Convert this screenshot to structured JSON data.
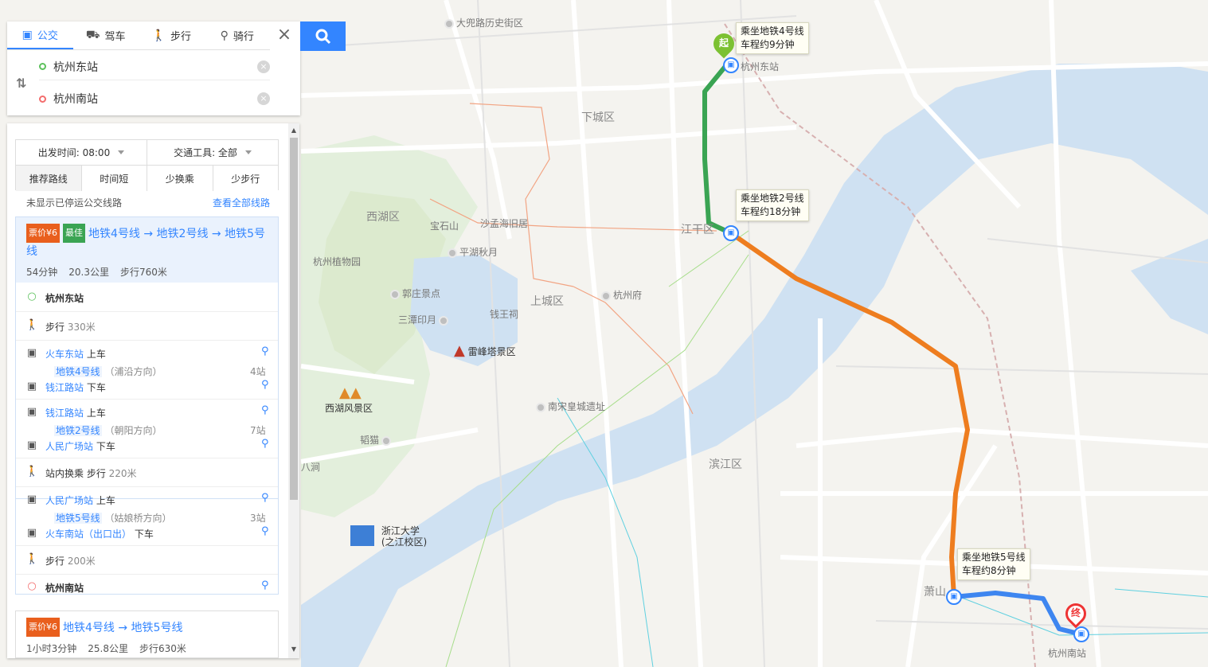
{
  "search": {
    "modes": [
      {
        "label": "公交",
        "icon": "bus-icon",
        "active": true
      },
      {
        "label": "驾车",
        "icon": "car-icon",
        "active": false
      },
      {
        "label": "步行",
        "icon": "walk-icon",
        "active": false
      },
      {
        "label": "骑行",
        "icon": "bike-icon",
        "active": false
      }
    ],
    "origin": "杭州东站",
    "destination": "杭州南站"
  },
  "filters": {
    "depart_time": "出发时间: 08:00",
    "transport": "交通工具: 全部",
    "sort_options": [
      "推荐路线",
      "时间短",
      "少换乘",
      "少步行"
    ],
    "hidden_note": "未显示已停运公交线路",
    "see_all": "查看全部线路"
  },
  "route1": {
    "price_tag": "票价¥6",
    "best_tag": "最佳",
    "title": "地铁4号线 → 地铁2号线 → 地铁5号线",
    "duration": "54分钟",
    "distance": "20.3公里",
    "walk": "步行760米",
    "steps": {
      "start": "杭州东站",
      "walk1": "步行",
      "walk1_dist": "330米",
      "s1_board_station": "火车东站",
      "s1_board": "上车",
      "s1_line": "地铁4号线",
      "s1_dir": "（浦沿方向）",
      "s1_stops": "4站",
      "s1_alight_station": "钱江路站",
      "s1_alight": "下车",
      "s2_board_station": "钱江路站",
      "s2_board": "上车",
      "s2_line": "地铁2号线",
      "s2_dir": "（朝阳方向）",
      "s2_stops": "7站",
      "s2_alight_station": "人民广场站",
      "s2_alight": "下车",
      "transfer": "站内换乘 步行",
      "transfer_dist": "220米",
      "s3_board_station": "人民广场站",
      "s3_board": "上车",
      "s3_line": "地铁5号线",
      "s3_dir": "（姑娘桥方向）",
      "s3_stops": "3站",
      "s3_alight_station": "火车南站（出口出）",
      "s3_alight": "下车",
      "walk2": "步行",
      "walk2_dist": "200米",
      "end": "杭州南站"
    }
  },
  "route2": {
    "price_tag": "票价¥6",
    "title": "地铁4号线 → 地铁5号线",
    "duration": "1小时3分钟",
    "distance": "25.8公里",
    "walk": "步行630米"
  },
  "map": {
    "callouts": {
      "c1a": "乘坐地铁4号线",
      "c1b": "车程约9分钟",
      "c2a": "乘坐地铁2号线",
      "c2b": "车程约18分钟",
      "c3a": "乘坐地铁5号线",
      "c3b": "车程约8分钟"
    },
    "start_marker": "起",
    "end_marker": "终",
    "labels": {
      "district_xiacheng": "下城区",
      "district_xihu": "西湖区",
      "district_jianggan": "江干区",
      "district_shangcheng": "上城区",
      "district_binjiang": "滨江区",
      "hangzhou_east": "杭州东站",
      "hangzhou_south": "杭州南站",
      "daxiang_street": "大兜路历史街区",
      "baoshi": "宝石山",
      "shaoyun": "沙孟海旧居",
      "pinghu": "平湖秋月",
      "zhiwuyuan": "杭州植物园",
      "guozhuang": "郭庄景点",
      "santan": "三潭印月",
      "qianwang": "钱王祠",
      "leifeng": "雷峰塔景区",
      "xihu_scenic": "西湖风景区",
      "nansong": "南宋皇城遗址",
      "hangzhou_fu": "杭州府",
      "zheda": "浙江大学",
      "zheda2": "(之江校区)",
      "xiaoshan": "萧山",
      "shaoyuan": "韬猫",
      "bajian": "八涧"
    }
  },
  "colors": {
    "accent": "#3385ff",
    "line4": "#3aa453",
    "line2": "#ee7d1f",
    "line5": "#3e86f0",
    "river": "#cfe1f2",
    "green": "#e3efdc"
  }
}
